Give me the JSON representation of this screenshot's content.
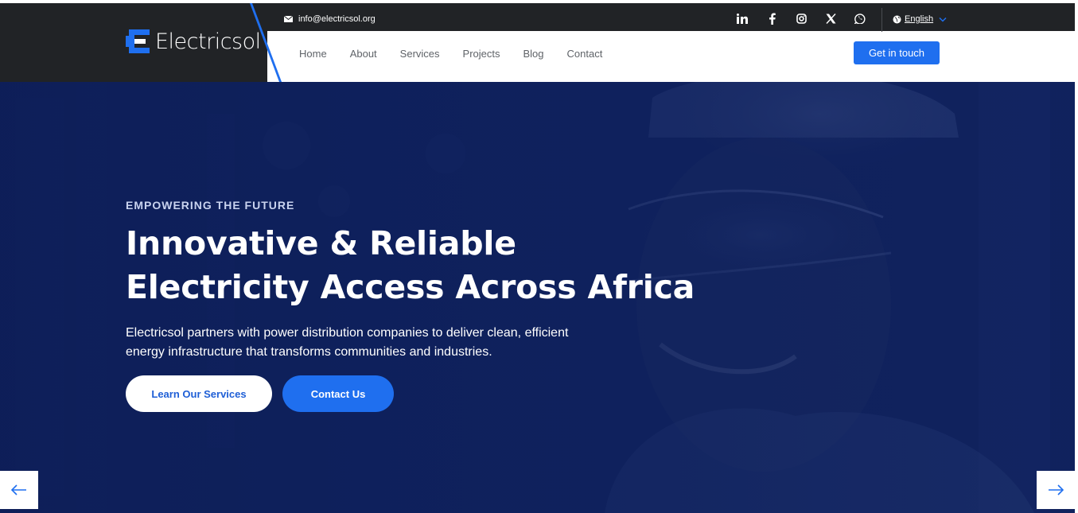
{
  "brand": {
    "name": "Electricsol",
    "accent": "#1f6fef",
    "dark": "#212326"
  },
  "topbar": {
    "email": "info@electricsol.org",
    "email_icon": "mail-icon",
    "socials": [
      "linkedin-icon",
      "facebook-icon",
      "instagram-icon",
      "x-icon",
      "whatsapp-icon"
    ],
    "language": "English"
  },
  "nav": {
    "items": [
      {
        "label": "Home"
      },
      {
        "label": "About"
      },
      {
        "label": "Services"
      },
      {
        "label": "Projects"
      },
      {
        "label": "Blog"
      },
      {
        "label": "Contact"
      }
    ],
    "cta_label": "Get in touch"
  },
  "hero": {
    "eyebrow": "EMPOWERING THE FUTURE",
    "headline": "Innovative & Reliable Electricity Access Across Africa",
    "subtext": "Electricsol partners with power distribution companies to deliver clean, efficient energy infrastructure that transforms communities and industries.",
    "primary_button": "Learn Our Services",
    "secondary_button": "Contact Us",
    "prev_icon": "arrow-left-icon",
    "next_icon": "arrow-right-icon"
  }
}
